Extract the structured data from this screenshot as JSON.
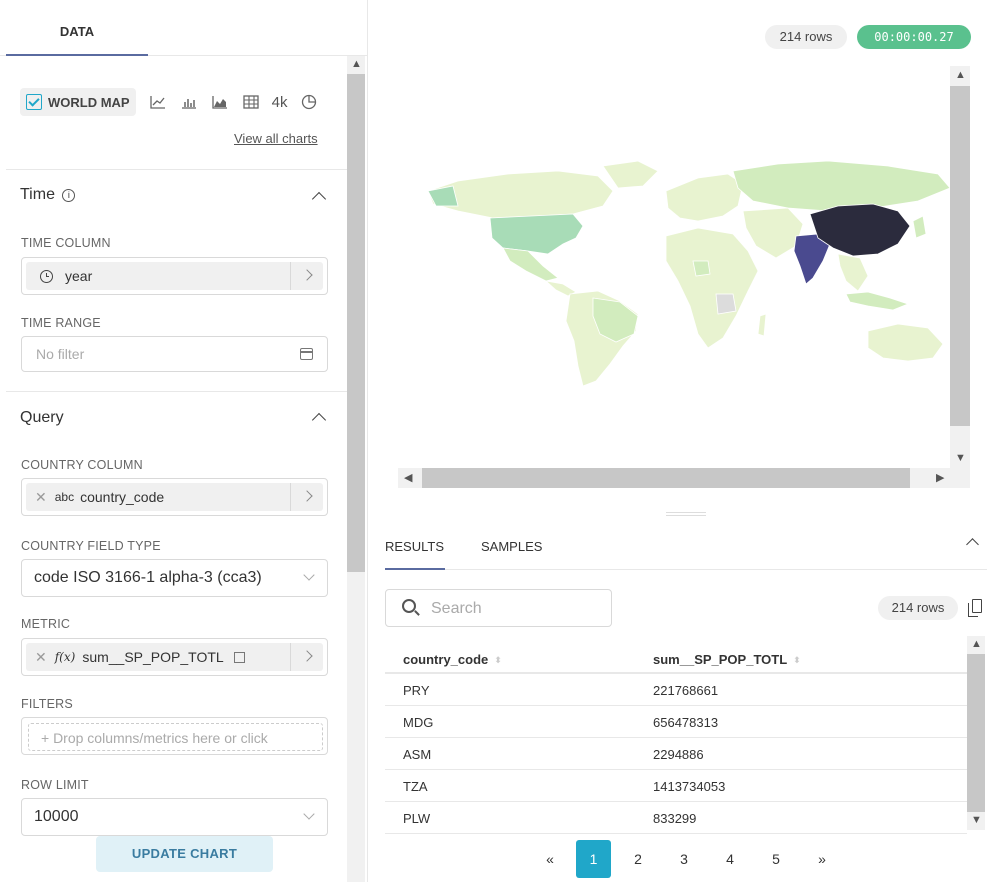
{
  "left_panel": {
    "tab_label": "DATA",
    "world_map_label": "WORLD MAP",
    "more_label": "4k",
    "view_all_charts": "View all charts",
    "time_section": {
      "title": "Time",
      "time_column_label": "TIME COLUMN",
      "time_column_value": "year",
      "time_range_label": "TIME RANGE",
      "time_range_placeholder": "No filter"
    },
    "query_section": {
      "title": "Query",
      "country_column_label": "COUNTRY COLUMN",
      "country_column_type": "abc",
      "country_column_value": "country_code",
      "country_field_type_label": "COUNTRY FIELD TYPE",
      "country_field_type_value": "code ISO 3166-1 alpha-3 (cca3)",
      "metric_label": "METRIC",
      "metric_prefix": "f(x)",
      "metric_value": "sum__SP_POP_TOTL",
      "filters_label": "FILTERS",
      "filters_placeholder": "+ Drop columns/metrics here or click",
      "row_limit_label": "ROW LIMIT",
      "row_limit_value": "10000"
    },
    "update_button": "UPDATE CHART"
  },
  "right_panel": {
    "rows_badge_top": "214 rows",
    "timer": "00:00:00.27",
    "tabs": [
      "RESULTS",
      "SAMPLES"
    ],
    "search_placeholder": "Search",
    "rows_badge_results": "214 rows",
    "table": {
      "columns": [
        "country_code",
        "sum__SP_POP_TOTL"
      ],
      "rows": [
        [
          "PRY",
          "221768661"
        ],
        [
          "MDG",
          "656478313"
        ],
        [
          "ASM",
          "2294886"
        ],
        [
          "TZA",
          "1413734053"
        ],
        [
          "PLW",
          "833299"
        ]
      ]
    },
    "pagination": {
      "prev": "«",
      "pages": [
        "1",
        "2",
        "3",
        "4",
        "5"
      ],
      "next": "»",
      "active": "1"
    }
  },
  "colors": {
    "accent": "#20a7c9",
    "timer_green": "#5ac18e",
    "map_china": "#2b2b3d",
    "map_india": "#4a4a8f",
    "map_usa": "#a8dcb7",
    "map_low": "#e8f3d0",
    "map_mid": "#d2ecbe"
  }
}
